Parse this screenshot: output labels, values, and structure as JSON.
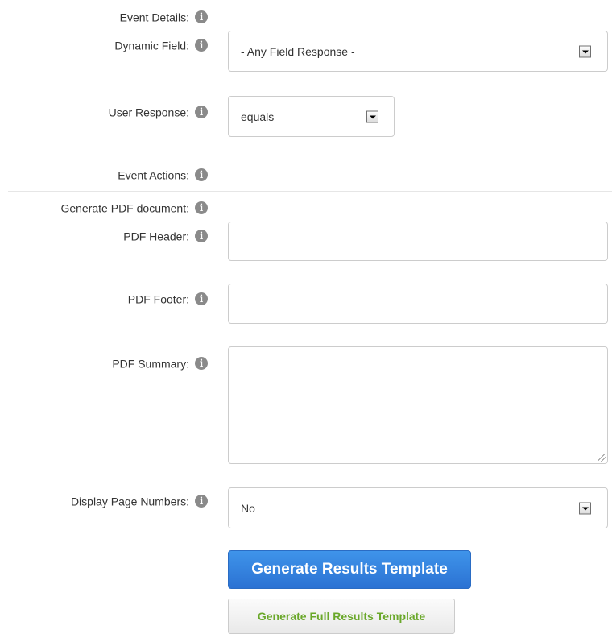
{
  "event_details": {
    "label": "Event Details:"
  },
  "dynamic_field": {
    "label": "Dynamic Field:",
    "value": "- Any Field Response -"
  },
  "user_response": {
    "label": "User Response:",
    "value": "equals"
  },
  "event_actions": {
    "label": "Event Actions:"
  },
  "generate_pdf": {
    "label": "Generate PDF document:"
  },
  "pdf_header": {
    "label": "PDF Header:",
    "value": ""
  },
  "pdf_footer": {
    "label": "PDF Footer:",
    "value": ""
  },
  "pdf_summary": {
    "label": "PDF Summary:",
    "value": ""
  },
  "display_page_numbers": {
    "label": "Display Page Numbers:",
    "value": "No"
  },
  "buttons": {
    "generate_results": "Generate Results Template",
    "generate_full_results": "Generate Full Results Template"
  },
  "icons": {
    "info": "info-icon"
  },
  "colors": {
    "primary_button": "#2b72d3",
    "secondary_button_text": "#6aa82a",
    "info_icon": "#8a8a8a",
    "field_border": "#cccccc"
  }
}
